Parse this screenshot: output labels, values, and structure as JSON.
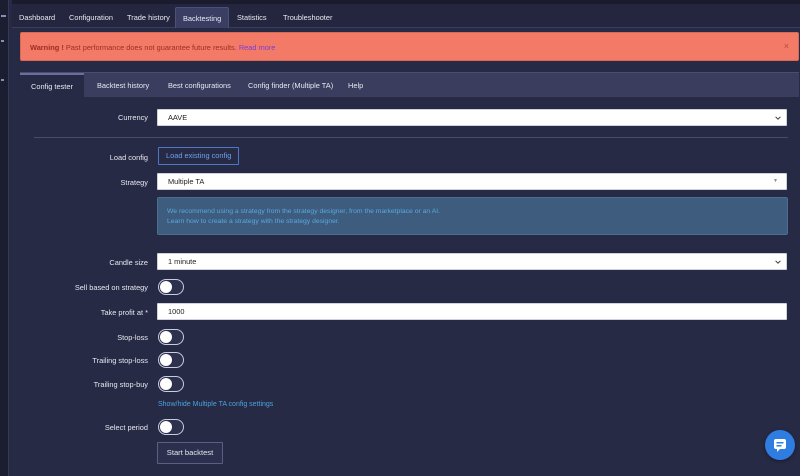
{
  "nav": {
    "tabs": [
      {
        "label": "Dashboard"
      },
      {
        "label": "Configuration"
      },
      {
        "label": "Trade history"
      },
      {
        "label": "Backtesting"
      },
      {
        "label": "Statistics"
      },
      {
        "label": "Troubleshooter"
      }
    ],
    "active": "Backtesting"
  },
  "warning": {
    "strong": "Warning !",
    "text": "Past performance does not guarantee future results.",
    "link": "Read more",
    "close": "×"
  },
  "subtabs": {
    "items": [
      {
        "label": "Config tester"
      },
      {
        "label": "Backtest history"
      },
      {
        "label": "Best configurations"
      },
      {
        "label": "Config finder (Multiple TA)"
      },
      {
        "label": "Help"
      }
    ],
    "active": "Config tester"
  },
  "form": {
    "currency": {
      "label": "Currency",
      "value": "AAVE"
    },
    "load_config": {
      "label": "Load config",
      "button": "Load existing config"
    },
    "strategy": {
      "label": "Strategy",
      "value": "Multiple TA",
      "caret": "▼"
    },
    "info": {
      "line1": "We recommend using a strategy from the strategy designer, from the marketplace or an AI.",
      "line2": "Learn how to create a strategy with the strategy designer."
    },
    "candle_size": {
      "label": "Candle size",
      "value": "1 minute"
    },
    "sell_based_on_strategy": {
      "label": "Sell based on strategy",
      "enabled": false
    },
    "take_profit": {
      "label": "Take profit at *",
      "value": "1000"
    },
    "stop_loss": {
      "label": "Stop-loss",
      "enabled": false
    },
    "trailing_stop_loss": {
      "label": "Trailing stop-loss",
      "enabled": false
    },
    "trailing_stop_buy": {
      "label": "Trailing stop-buy",
      "enabled": false
    },
    "show_hide_link": "Show/hide Multiple TA config settings",
    "select_period": {
      "label": "Select period",
      "enabled": false
    },
    "start_button": "Start backtest"
  },
  "colors": {
    "background": "#272a45",
    "warning": "#f27a66",
    "info": "#3d5c7e",
    "accent": "#2f7de0"
  },
  "icons": {
    "chevron": "chevron-down-icon",
    "close": "close-icon",
    "chat": "chat-icon"
  }
}
